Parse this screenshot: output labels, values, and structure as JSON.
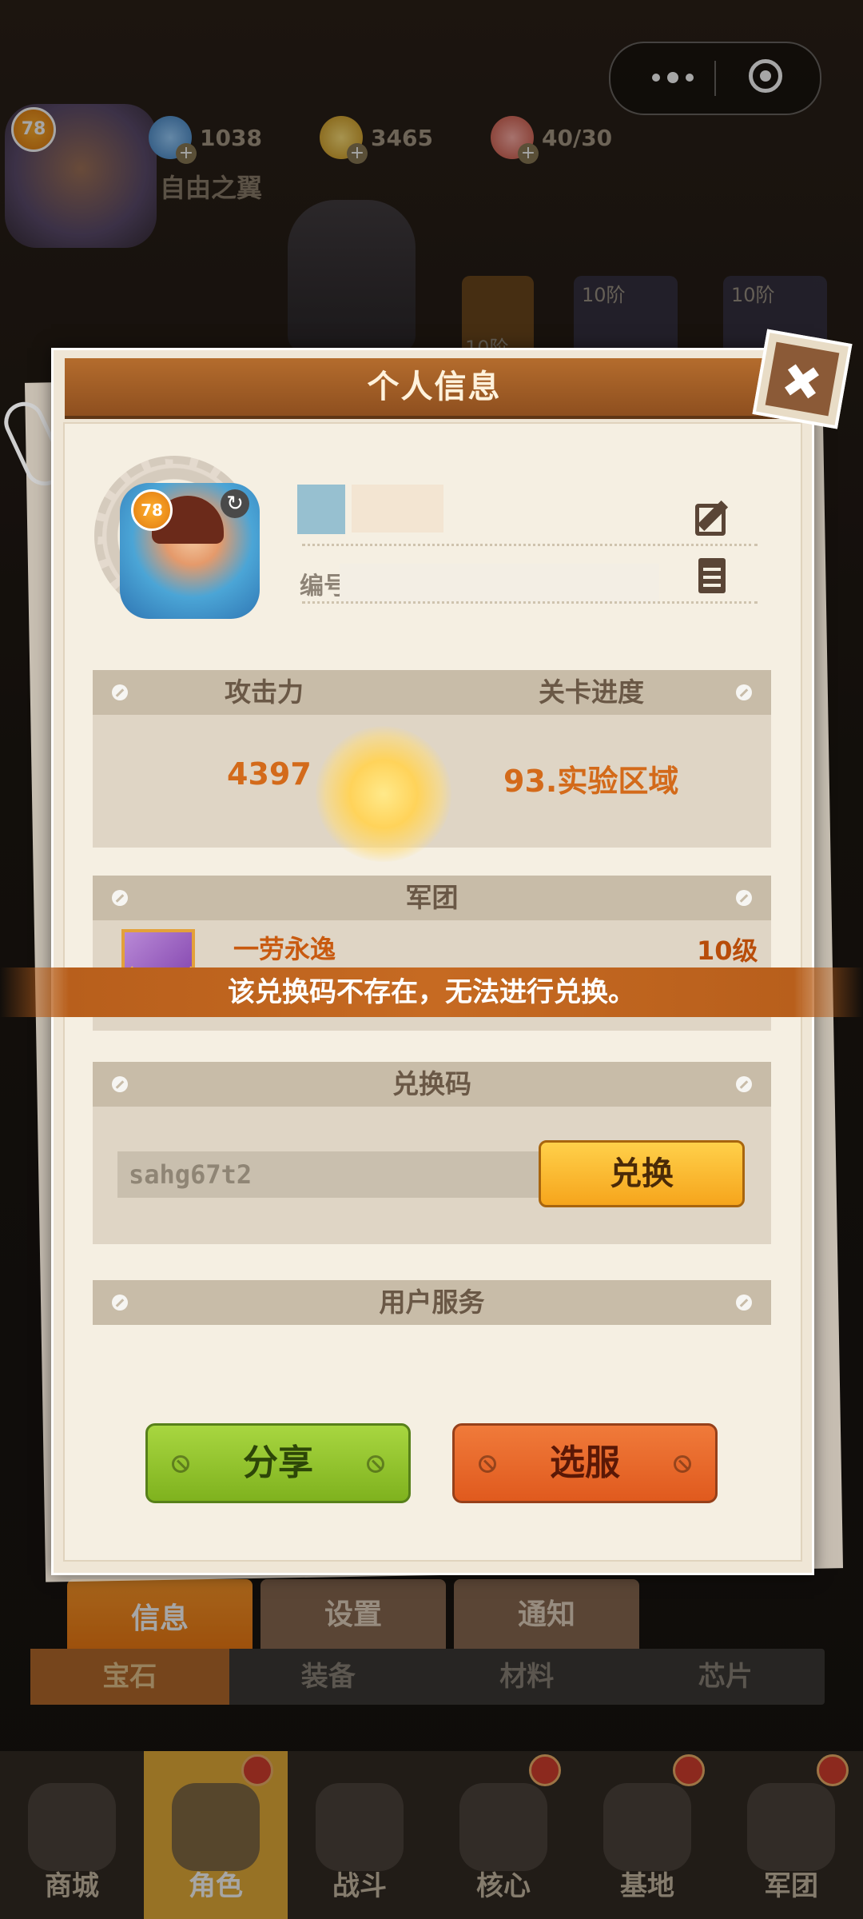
{
  "top_bar": {
    "player_level": "78",
    "player_name": "自由之翼",
    "resources": [
      {
        "icon": "gem-icon",
        "value": "1038"
      },
      {
        "icon": "gold-coin-icon",
        "value": "3465"
      },
      {
        "icon": "meat-stamina-icon",
        "value": "40/30"
      }
    ],
    "bg_level_tags": [
      "10阶",
      "10阶",
      "10阶"
    ]
  },
  "modal": {
    "title": "个人信息",
    "profile": {
      "level": "78",
      "id_label": "编号"
    },
    "stats": {
      "attack_label": "攻击力",
      "progress_label": "关卡进度",
      "attack_value": "4397",
      "progress_value": "93.实验区域"
    },
    "legion": {
      "header": "军团",
      "name": "一劳永逸",
      "level": "10级"
    },
    "redeem": {
      "header": "兑换码",
      "code_value": "sahg67t2",
      "button_label": "兑换"
    },
    "user_service": {
      "header": "用户服务"
    },
    "share_label": "分享",
    "select_server_label": "选服"
  },
  "toast": {
    "message": "该兑换码不存在，无法进行兑换。"
  },
  "tabs": {
    "items": [
      "信息",
      "设置",
      "通知"
    ],
    "active": "信息"
  },
  "sub_tabs": {
    "items": [
      "宝石",
      "装备",
      "材料",
      "芯片"
    ],
    "active": "宝石"
  },
  "bottom_nav": {
    "items": [
      "商城",
      "角色",
      "战斗",
      "核心",
      "基地",
      "军团"
    ],
    "active": "角色"
  },
  "colors": {
    "header_brown": "#9a5a25",
    "accent_orange": "#d36a1a",
    "redeem_yellow": "#f6a51c",
    "share_green": "#8fc12a",
    "server_orange": "#e8682a",
    "toast_bg": "#c66a22"
  }
}
